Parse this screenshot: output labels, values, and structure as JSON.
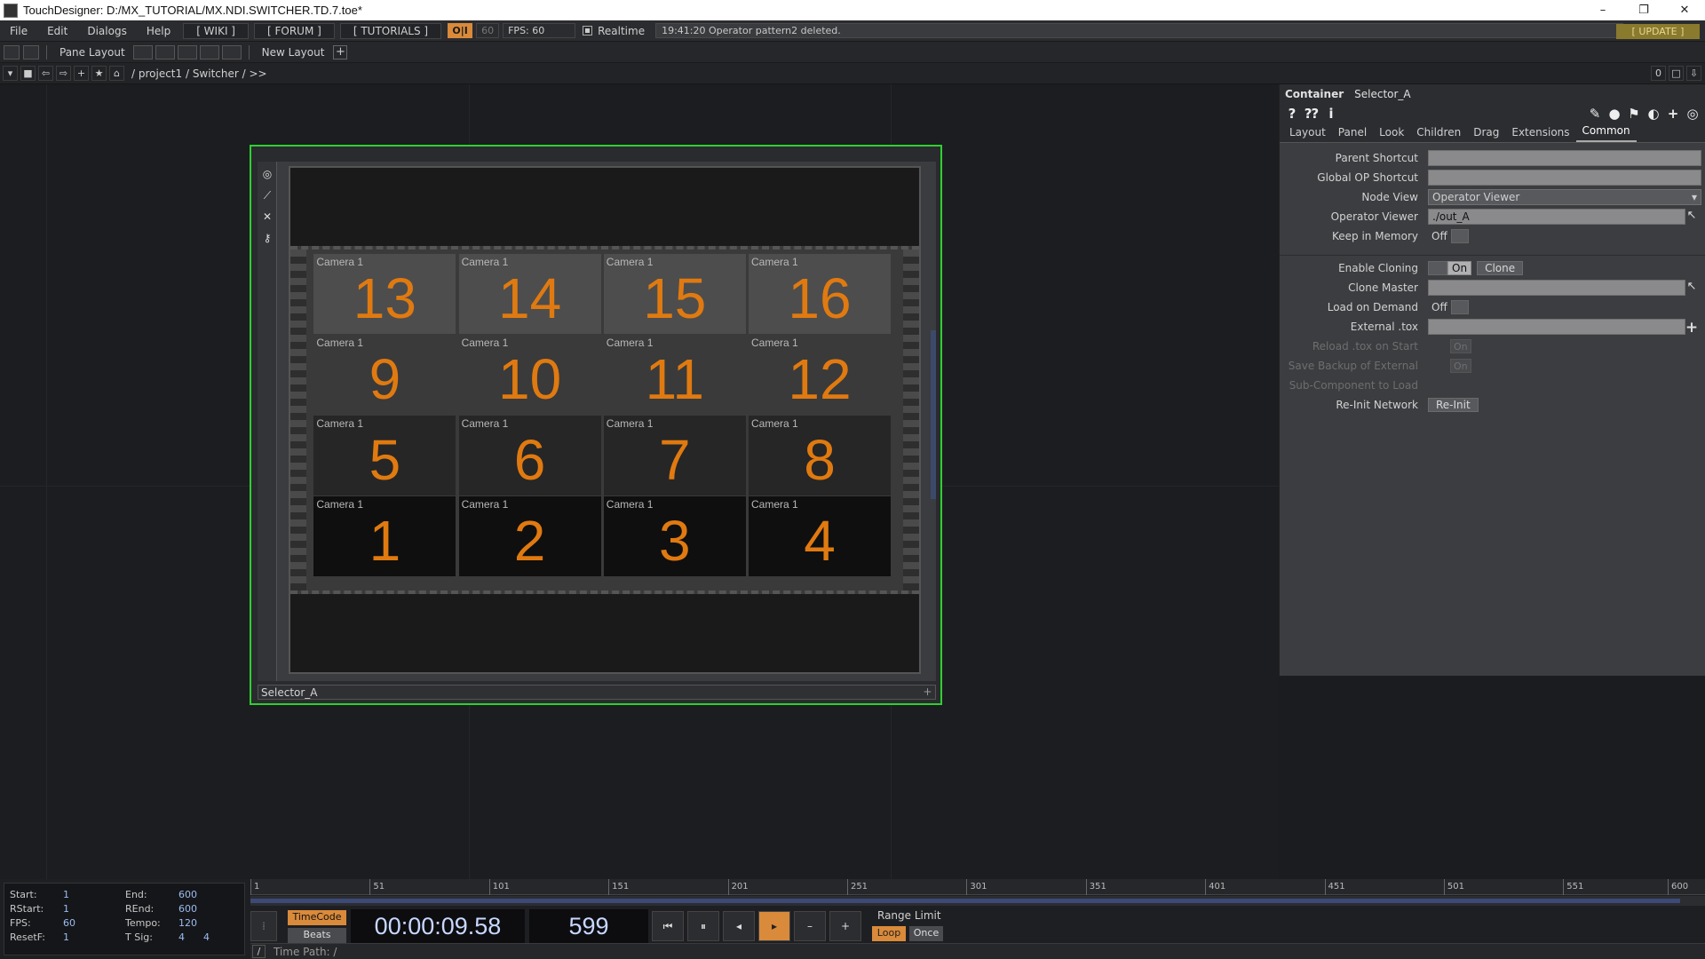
{
  "window": {
    "title": "TouchDesigner: D:/MX_TUTORIAL/MX.NDI.SWITCHER.TD.7.toe*",
    "minimize": "–",
    "restore": "❐",
    "close": "✕"
  },
  "menubar": {
    "items": [
      "File",
      "Edit",
      "Dialogs",
      "Help"
    ],
    "wiki": "[ WIKI ]",
    "forum": "[ FORUM ]",
    "tutorials": "[ TUTORIALS ]",
    "oi": "O|I",
    "fps_small": "60",
    "fps": "FPS:  60",
    "realtime": "Realtime",
    "status_message": "19:41:20 Operator pattern2 deleted.",
    "update": "[ UPDATE ]"
  },
  "toolbar": {
    "pane_layout": "Pane Layout",
    "new_layout": "New Layout",
    "plus": "+"
  },
  "pathbar": {
    "path": "/ project1 / Switcher / >>",
    "right_value": "0"
  },
  "node": {
    "name": "Selector_A",
    "add": "+",
    "cameras": [
      {
        "label": "Camera 1",
        "number": "13",
        "row": 0,
        "col": 0
      },
      {
        "label": "Camera 1",
        "number": "14",
        "row": 0,
        "col": 1
      },
      {
        "label": "Camera 1",
        "number": "15",
        "row": 0,
        "col": 2
      },
      {
        "label": "Camera 1",
        "number": "16",
        "row": 0,
        "col": 3
      },
      {
        "label": "Camera 1",
        "number": "9",
        "row": 1,
        "col": 0
      },
      {
        "label": "Camera 1",
        "number": "10",
        "row": 1,
        "col": 1
      },
      {
        "label": "Camera 1",
        "number": "11",
        "row": 1,
        "col": 2
      },
      {
        "label": "Camera 1",
        "number": "12",
        "row": 1,
        "col": 3
      },
      {
        "label": "Camera 1",
        "number": "5",
        "row": 2,
        "col": 0
      },
      {
        "label": "Camera 1",
        "number": "6",
        "row": 2,
        "col": 1
      },
      {
        "label": "Camera 1",
        "number": "7",
        "row": 2,
        "col": 2
      },
      {
        "label": "Camera 1",
        "number": "8",
        "row": 2,
        "col": 3
      },
      {
        "label": "Camera 1",
        "number": "1",
        "row": 3,
        "col": 0
      },
      {
        "label": "Camera 1",
        "number": "2",
        "row": 3,
        "col": 1
      },
      {
        "label": "Camera 1",
        "number": "3",
        "row": 3,
        "col": 2
      },
      {
        "label": "Camera 1",
        "number": "4",
        "row": 3,
        "col": 3
      }
    ]
  },
  "params": {
    "op_type": "Container",
    "op_name": "Selector_A",
    "tabs": [
      "Layout",
      "Panel",
      "Look",
      "Children",
      "Drag",
      "Extensions",
      "Common"
    ],
    "active_tab": "Common",
    "parent_shortcut": {
      "label": "Parent Shortcut",
      "value": ""
    },
    "global_op_shortcut": {
      "label": "Global OP Shortcut",
      "value": ""
    },
    "node_view": {
      "label": "Node View",
      "value": "Operator Viewer"
    },
    "operator_viewer": {
      "label": "Operator Viewer",
      "value": "./out_A"
    },
    "keep_in_memory": {
      "label": "Keep in Memory",
      "value": "Off"
    },
    "enable_cloning": {
      "label": "Enable Cloning",
      "value": "On",
      "button": "Clone"
    },
    "clone_master": {
      "label": "Clone Master",
      "value": ""
    },
    "load_on_demand": {
      "label": "Load on Demand",
      "value": "Off"
    },
    "external_tox": {
      "label": "External .tox",
      "value": ""
    },
    "reload_tox": {
      "label": "Reload .tox on Start",
      "value": "On"
    },
    "save_backup": {
      "label": "Save Backup of External",
      "value": "On"
    },
    "sub_component": {
      "label": "Sub-Component to Load"
    },
    "reinit_network": {
      "label": "Re-Init Network",
      "button": "Re-Init"
    }
  },
  "timeline": {
    "ticks": [
      "1",
      "51",
      "101",
      "151",
      "201",
      "251",
      "301",
      "351",
      "401",
      "451",
      "501",
      "551",
      "600"
    ],
    "start": {
      "label": "Start:",
      "value": "1"
    },
    "end": {
      "label": "End:",
      "value": "600"
    },
    "rstart": {
      "label": "RStart:",
      "value": "1"
    },
    "rend": {
      "label": "REnd:",
      "value": "600"
    },
    "fps": {
      "label": "FPS:",
      "value": "60"
    },
    "tempo": {
      "label": "Tempo:",
      "value": "120"
    },
    "resetf": {
      "label": "ResetF:",
      "value": "1"
    },
    "tsig": {
      "label": "T Sig:",
      "value": "4      4"
    },
    "timecode_mode": "TimeCode",
    "beats_mode": "Beats",
    "timecode": "00:00:09.58",
    "frame": "599",
    "range_limit": "Range Limit",
    "loop": "Loop",
    "once": "Once",
    "time_path_label": "Time Path: /"
  }
}
